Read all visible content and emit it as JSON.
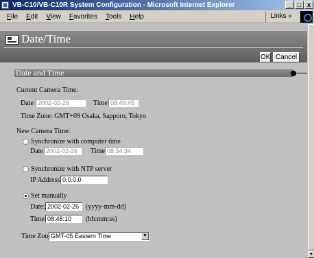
{
  "window": {
    "title": "VB-C10/VB-C10R System Configuration - Microsoft Internet Explorer",
    "minimize": "_",
    "maximize": "□",
    "close": "x"
  },
  "menubar": {
    "items": [
      "File",
      "Edit",
      "View",
      "Favorites",
      "Tools",
      "Help"
    ],
    "links": "Links »"
  },
  "header": {
    "title": "Date/Time",
    "ok_label": "OK",
    "cancel_label": "Cancel"
  },
  "section": {
    "title": "Date and Time"
  },
  "current": {
    "heading": "Current Camera Time:",
    "date_label": "Date",
    "date_value": "2002-02-26",
    "time_label": "Time",
    "time_value": "08:49:45",
    "timezone_text": "Time Zone: GMT+09 Osaka, Sapporo, Tokyo"
  },
  "new_time": {
    "heading": "New Camera Time:",
    "sync_computer": {
      "label": "Synchronize with computer time",
      "date_label": "Date",
      "date_value": "2002-02-26",
      "time_label": "Time",
      "time_value": "08:54:34",
      "selected": false
    },
    "sync_ntp": {
      "label": "Synchronize with NTP server",
      "ip_label": "IP Address:",
      "ip_value": "0.0.0.0",
      "selected": false
    },
    "manual": {
      "label": "Set manually",
      "date_label": "Date:",
      "date_value": "2002-02-26",
      "date_hint": "(yyyy-mm-dd)",
      "time_label": "Time:",
      "time_value": "08:48:10",
      "time_hint": "(hh:mm:ss)",
      "selected": true
    }
  },
  "timezone": {
    "label": "Time Zone:",
    "selected": "GMT-05 Eastern Time"
  }
}
